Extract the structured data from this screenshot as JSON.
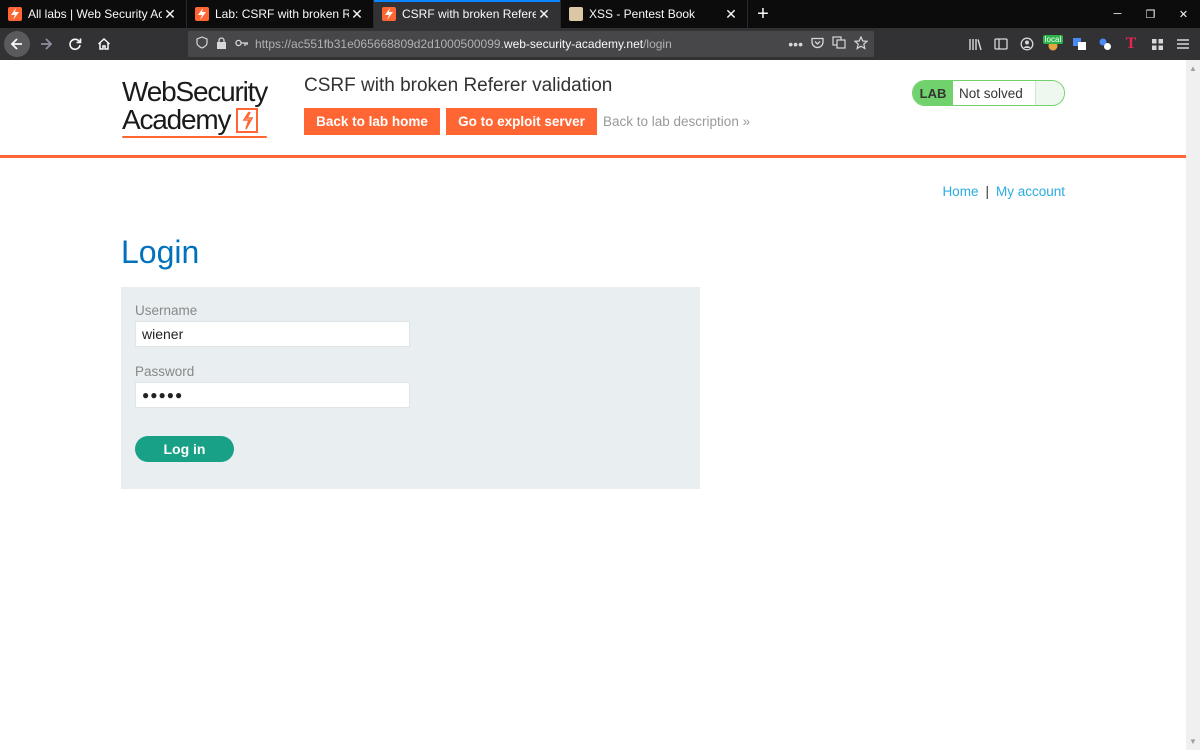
{
  "browser": {
    "tabs": [
      {
        "title": "All labs | Web Security Academ",
        "icon": "portswigger-icon"
      },
      {
        "title": "Lab: CSRF with broken Referer",
        "icon": "portswigger-icon"
      },
      {
        "title": "CSRF with broken Referer valid",
        "icon": "portswigger-icon",
        "active": true
      },
      {
        "title": "XSS - Pentest Book",
        "icon": "gitbook-icon"
      }
    ],
    "new_tab": "+",
    "url_scheme": "https://ac551fb31e065668809d2d1000500099.",
    "url_host": "web-security-academy.net",
    "url_path": "/login",
    "extension_badge": "local"
  },
  "header": {
    "logo_line1": "WebSecurity",
    "logo_line2": "Academy",
    "lab_title": "CSRF with broken Referer validation",
    "back_to_lab_home": "Back to lab home",
    "go_to_exploit_server": "Go to exploit server",
    "back_to_lab_description": "Back to lab description",
    "back_arrow": "»",
    "lab_badge": "LAB",
    "lab_status": "Not solved"
  },
  "nav": {
    "home": "Home",
    "separator": "|",
    "my_account": "My account"
  },
  "login": {
    "heading": "Login",
    "username_label": "Username",
    "username_value": "wiener",
    "password_label": "Password",
    "password_value": "●●●●●",
    "submit": "Log in"
  },
  "colors": {
    "accent": "#ff6633",
    "link": "#29abe2",
    "heading": "#0071bc",
    "lab_green": "#70d16d",
    "button_green": "#18a186",
    "form_bg": "#e9eef0"
  }
}
